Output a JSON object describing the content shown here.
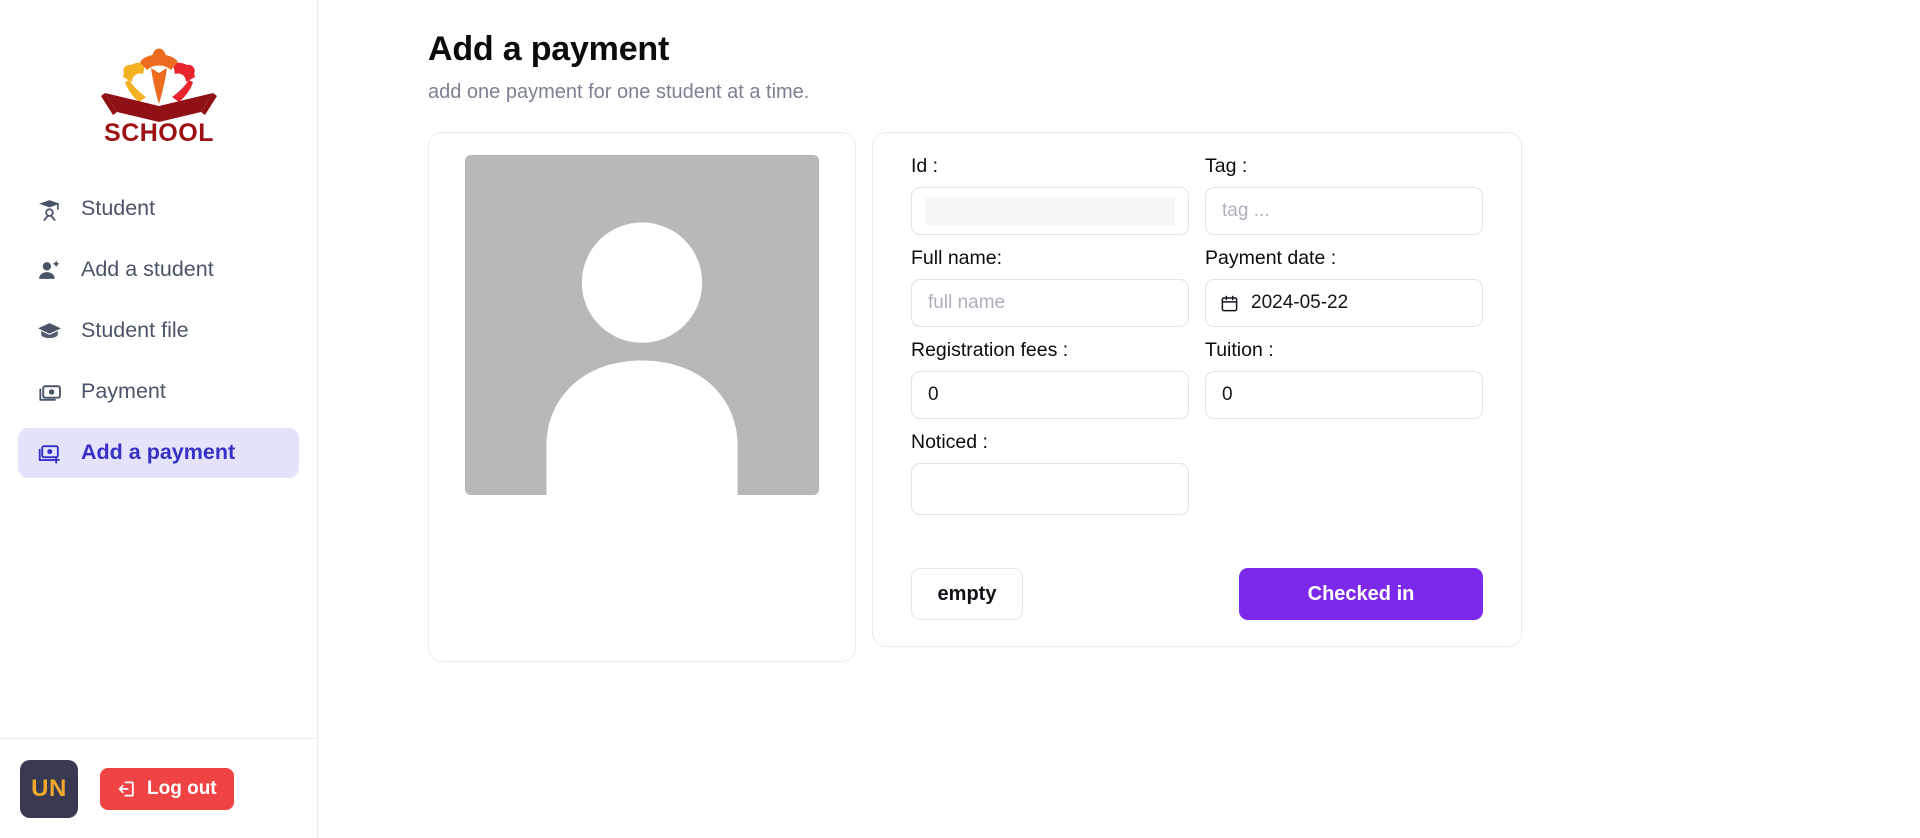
{
  "sidebar": {
    "logo": {
      "text": "SCHOOL",
      "icon": "school-book-people-logo"
    },
    "items": [
      {
        "label": "Student",
        "icon": "graduate-person-icon",
        "active": false
      },
      {
        "label": "Add a student",
        "icon": "person-plus-icon",
        "active": false
      },
      {
        "label": "Student file",
        "icon": "graduation-cap-icon",
        "active": false
      },
      {
        "label": "Payment",
        "icon": "banknote-icon",
        "active": false
      },
      {
        "label": "Add a payment",
        "icon": "banknote-plus-icon",
        "active": true
      }
    ],
    "footer": {
      "avatar_initials": "UN",
      "logout_label": "Log out",
      "logout_icon": "logout-arrow-icon"
    }
  },
  "main": {
    "title": "Add a payment",
    "subtitle": "add one payment for one student at a time.",
    "photo": {
      "icon": "person-placeholder-icon"
    },
    "form": {
      "fields": {
        "id": {
          "label": "Id :",
          "value": "",
          "placeholder": ""
        },
        "tag": {
          "label": "Tag :",
          "value": "",
          "placeholder": "tag ..."
        },
        "fullname": {
          "label": "Full name:",
          "value": "",
          "placeholder": "full name"
        },
        "date": {
          "label": "Payment date :",
          "value": "2024-05-22",
          "icon": "calendar-icon"
        },
        "registration": {
          "label": "Registration fees :",
          "value": "0",
          "placeholder": "0"
        },
        "tuition": {
          "label": "Tuition :",
          "value": "0",
          "placeholder": "0"
        },
        "noticed": {
          "label": "Noticed :",
          "value": "",
          "placeholder": ""
        }
      },
      "buttons": {
        "empty_label": "empty",
        "submit_label": "Checked in"
      }
    }
  },
  "colors": {
    "accent_purple": "#7c28ed",
    "active_nav_bg": "#e3e3fb",
    "active_nav_text": "#3730c9",
    "logout_red": "#f04444",
    "avatar_bg": "#393a52",
    "avatar_text": "#f0a92a"
  }
}
